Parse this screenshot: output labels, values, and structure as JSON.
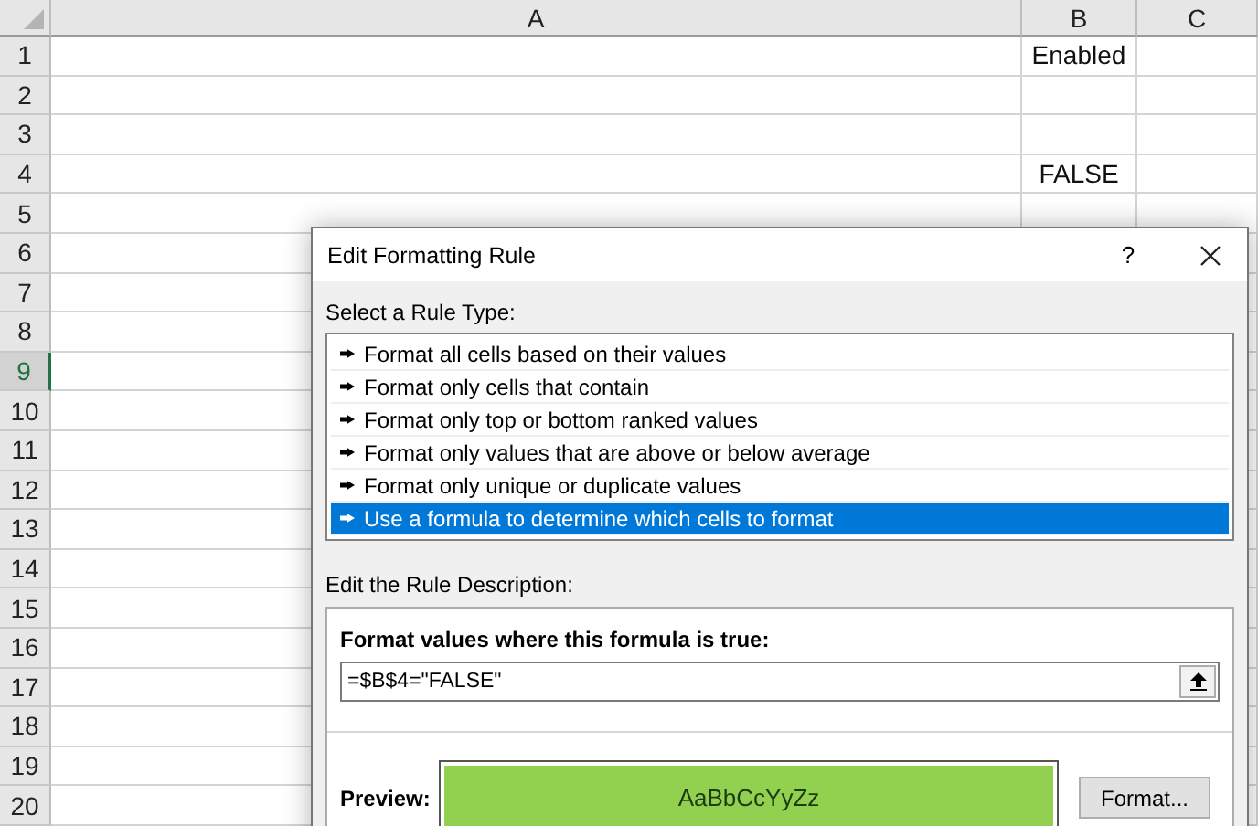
{
  "sheet": {
    "columns": [
      {
        "label": "A"
      },
      {
        "label": "B"
      },
      {
        "label": "C"
      }
    ],
    "rows": [
      {
        "label": "1",
        "selected": false,
        "cells": [
          "",
          "Enabled",
          ""
        ]
      },
      {
        "label": "2",
        "selected": false,
        "cells": [
          "",
          "",
          ""
        ]
      },
      {
        "label": "3",
        "selected": false,
        "cells": [
          "",
          "",
          ""
        ]
      },
      {
        "label": "4",
        "selected": false,
        "cells": [
          "",
          "FALSE",
          ""
        ]
      },
      {
        "label": "5",
        "selected": false,
        "cells": [
          "",
          "",
          ""
        ]
      },
      {
        "label": "6",
        "selected": false,
        "cells": [
          "",
          "",
          ""
        ]
      },
      {
        "label": "7",
        "selected": false,
        "cells": [
          "",
          "",
          ""
        ]
      },
      {
        "label": "8",
        "selected": false,
        "cells": [
          "",
          "",
          ""
        ]
      },
      {
        "label": "9",
        "selected": true,
        "cells": [
          "",
          "",
          ""
        ]
      },
      {
        "label": "10",
        "selected": false,
        "cells": [
          "",
          "",
          ""
        ]
      },
      {
        "label": "11",
        "selected": false,
        "cells": [
          "",
          "",
          ""
        ]
      },
      {
        "label": "12",
        "selected": false,
        "cells": [
          "",
          "",
          ""
        ]
      },
      {
        "label": "13",
        "selected": false,
        "cells": [
          "",
          "",
          ""
        ]
      },
      {
        "label": "14",
        "selected": false,
        "cells": [
          "",
          "",
          ""
        ]
      },
      {
        "label": "15",
        "selected": false,
        "cells": [
          "",
          "",
          ""
        ]
      },
      {
        "label": "16",
        "selected": false,
        "cells": [
          "",
          "",
          ""
        ]
      },
      {
        "label": "17",
        "selected": false,
        "cells": [
          "",
          "",
          ""
        ]
      },
      {
        "label": "18",
        "selected": false,
        "cells": [
          "",
          "",
          ""
        ]
      },
      {
        "label": "19",
        "selected": false,
        "cells": [
          "",
          "",
          ""
        ]
      },
      {
        "label": "20",
        "selected": false,
        "cells": [
          "",
          "",
          ""
        ]
      }
    ]
  },
  "dialog": {
    "title": "Edit Formatting Rule",
    "help": "?",
    "rule_type_label": "Select a Rule Type:",
    "rule_types": [
      {
        "label": "Format all cells based on their values",
        "selected": false
      },
      {
        "label": "Format only cells that contain",
        "selected": false
      },
      {
        "label": "Format only top or bottom ranked values",
        "selected": false
      },
      {
        "label": "Format only values that are above or below average",
        "selected": false
      },
      {
        "label": "Format only unique or duplicate values",
        "selected": false
      },
      {
        "label": "Use a formula to determine which cells to format",
        "selected": true
      }
    ],
    "description_label": "Edit the Rule Description:",
    "formula_label": "Format values where this formula is true:",
    "formula": "=$B$4=\"FALSE\"",
    "preview_label": "Preview:",
    "preview_text": "AaBbCcYyZz",
    "format_button": "Format..."
  }
}
